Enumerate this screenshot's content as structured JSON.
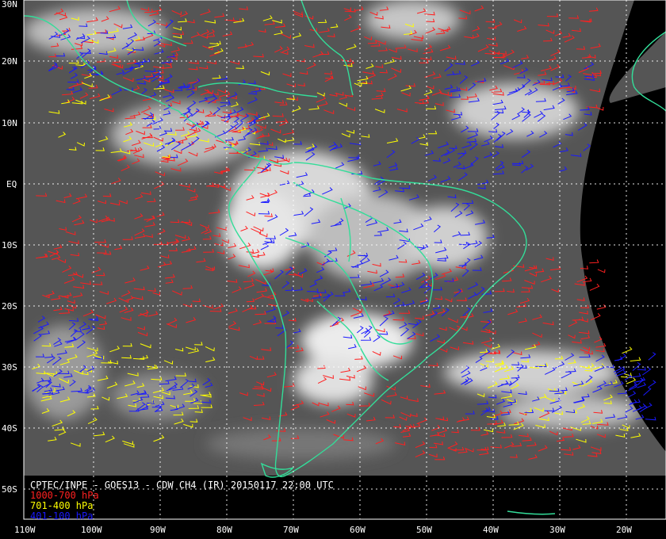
{
  "map": {
    "title": "CPTEC/INPE - GOES13 - CDW CH4 (IR) 20150117 22:00 UTC",
    "lat_labels": [
      "30N",
      "20N",
      "10N",
      "EQ",
      "10S",
      "20S",
      "30S",
      "40S",
      "50S"
    ],
    "lon_labels": [
      "110W",
      "100W",
      "90W",
      "80W",
      "70W",
      "60W",
      "50W",
      "40W",
      "30W",
      "20W"
    ],
    "legend": [
      {
        "label": "1000-700 hPa",
        "color": "#ff2020"
      },
      {
        "label": "701-400 hPa",
        "color": "#ffff00"
      },
      {
        "label": "401-100 hPa",
        "color": "#1a1aff"
      }
    ],
    "colors": {
      "coastline": "#33dd99",
      "grid": "#ffffff",
      "background": "#000000",
      "satellite_gray": "#5a5a5a"
    }
  }
}
